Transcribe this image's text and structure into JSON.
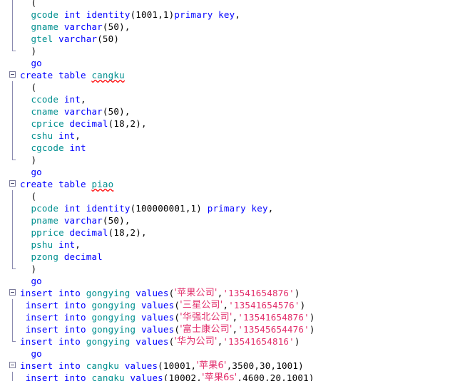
{
  "app": {
    "name": "sql-query-editor",
    "background": "#ffffff",
    "font_size_px": 12.5,
    "line_height_px": 17
  },
  "colors": {
    "keyword": "#0000ff",
    "identifier": "#008f8f",
    "string": "#e2306c",
    "plain": "#000000",
    "squiggle": "#ff0000",
    "region_bar": "#8b8bb0",
    "collapse_border": "#7d7d9c",
    "background": "#ffffff"
  },
  "icons": {
    "collapse": "minus-square-icon",
    "region_line": "region-bracket-icon"
  },
  "editor": {
    "lines": [
      {
        "n": 1,
        "gutter": "vbar",
        "tokens": [
          {
            "t": "  (",
            "c": "plain"
          }
        ]
      },
      {
        "n": 2,
        "gutter": "vbar",
        "tokens": [
          {
            "t": "  ",
            "c": "plain"
          },
          {
            "t": "gcode",
            "c": "ident"
          },
          {
            "t": " ",
            "c": "plain"
          },
          {
            "t": "int",
            "c": "kw"
          },
          {
            "t": " ",
            "c": "plain"
          },
          {
            "t": "identity",
            "c": "kw"
          },
          {
            "t": "(1001,1)",
            "c": "plain"
          },
          {
            "t": "primary key",
            "c": "kw"
          },
          {
            "t": ",",
            "c": "plain"
          }
        ]
      },
      {
        "n": 3,
        "gutter": "vbar",
        "tokens": [
          {
            "t": "  ",
            "c": "plain"
          },
          {
            "t": "gname",
            "c": "ident"
          },
          {
            "t": " ",
            "c": "plain"
          },
          {
            "t": "varchar",
            "c": "kw"
          },
          {
            "t": "(50),",
            "c": "plain"
          }
        ]
      },
      {
        "n": 4,
        "gutter": "vbar",
        "tokens": [
          {
            "t": "  ",
            "c": "plain"
          },
          {
            "t": "gtel",
            "c": "ident"
          },
          {
            "t": " ",
            "c": "plain"
          },
          {
            "t": "varchar",
            "c": "kw"
          },
          {
            "t": "(50)",
            "c": "plain"
          }
        ]
      },
      {
        "n": 5,
        "gutter": "lbar",
        "tokens": [
          {
            "t": "  )",
            "c": "plain"
          }
        ]
      },
      {
        "n": 6,
        "gutter": "none",
        "tokens": [
          {
            "t": "  ",
            "c": "plain"
          },
          {
            "t": "go",
            "c": "kw"
          }
        ]
      },
      {
        "n": 7,
        "gutter": "collapse",
        "tokens": [
          {
            "t": "create table",
            "c": "kw"
          },
          {
            "t": " ",
            "c": "plain"
          },
          {
            "t": "cangku",
            "c": "err"
          }
        ]
      },
      {
        "n": 8,
        "gutter": "vbar",
        "tokens": [
          {
            "t": "  (",
            "c": "plain"
          }
        ]
      },
      {
        "n": 9,
        "gutter": "vbar",
        "tokens": [
          {
            "t": "  ",
            "c": "plain"
          },
          {
            "t": "ccode",
            "c": "ident"
          },
          {
            "t": " ",
            "c": "plain"
          },
          {
            "t": "int",
            "c": "kw"
          },
          {
            "t": ",",
            "c": "plain"
          }
        ]
      },
      {
        "n": 10,
        "gutter": "vbar",
        "tokens": [
          {
            "t": "  ",
            "c": "plain"
          },
          {
            "t": "cname",
            "c": "ident"
          },
          {
            "t": " ",
            "c": "plain"
          },
          {
            "t": "varchar",
            "c": "kw"
          },
          {
            "t": "(50),",
            "c": "plain"
          }
        ]
      },
      {
        "n": 11,
        "gutter": "vbar",
        "tokens": [
          {
            "t": "  ",
            "c": "plain"
          },
          {
            "t": "cprice",
            "c": "ident"
          },
          {
            "t": " ",
            "c": "plain"
          },
          {
            "t": "decimal",
            "c": "kw"
          },
          {
            "t": "(18,2),",
            "c": "plain"
          }
        ]
      },
      {
        "n": 12,
        "gutter": "vbar",
        "tokens": [
          {
            "t": "  ",
            "c": "plain"
          },
          {
            "t": "cshu",
            "c": "ident"
          },
          {
            "t": " ",
            "c": "plain"
          },
          {
            "t": "int",
            "c": "kw"
          },
          {
            "t": ",",
            "c": "plain"
          }
        ]
      },
      {
        "n": 13,
        "gutter": "vbar",
        "tokens": [
          {
            "t": "  ",
            "c": "plain"
          },
          {
            "t": "cgcode",
            "c": "ident"
          },
          {
            "t": " ",
            "c": "plain"
          },
          {
            "t": "int",
            "c": "kw"
          }
        ]
      },
      {
        "n": 14,
        "gutter": "lbar",
        "tokens": [
          {
            "t": "  )",
            "c": "plain"
          }
        ]
      },
      {
        "n": 15,
        "gutter": "none",
        "tokens": [
          {
            "t": "  ",
            "c": "plain"
          },
          {
            "t": "go",
            "c": "kw"
          }
        ]
      },
      {
        "n": 16,
        "gutter": "collapse",
        "tokens": [
          {
            "t": "create table",
            "c": "kw"
          },
          {
            "t": " ",
            "c": "plain"
          },
          {
            "t": "piao",
            "c": "err"
          }
        ]
      },
      {
        "n": 17,
        "gutter": "vbar",
        "tokens": [
          {
            "t": "  (",
            "c": "plain"
          }
        ]
      },
      {
        "n": 18,
        "gutter": "vbar",
        "tokens": [
          {
            "t": "  ",
            "c": "plain"
          },
          {
            "t": "pcode",
            "c": "ident"
          },
          {
            "t": " ",
            "c": "plain"
          },
          {
            "t": "int",
            "c": "kw"
          },
          {
            "t": " ",
            "c": "plain"
          },
          {
            "t": "identity",
            "c": "kw"
          },
          {
            "t": "(100000001,1) ",
            "c": "plain"
          },
          {
            "t": "primary key",
            "c": "kw"
          },
          {
            "t": ",",
            "c": "plain"
          }
        ]
      },
      {
        "n": 19,
        "gutter": "vbar",
        "tokens": [
          {
            "t": "  ",
            "c": "plain"
          },
          {
            "t": "pname",
            "c": "ident"
          },
          {
            "t": " ",
            "c": "plain"
          },
          {
            "t": "varchar",
            "c": "kw"
          },
          {
            "t": "(50),",
            "c": "plain"
          }
        ]
      },
      {
        "n": 20,
        "gutter": "vbar",
        "tokens": [
          {
            "t": "  ",
            "c": "plain"
          },
          {
            "t": "pprice",
            "c": "ident"
          },
          {
            "t": " ",
            "c": "plain"
          },
          {
            "t": "decimal",
            "c": "kw"
          },
          {
            "t": "(18,2),",
            "c": "plain"
          }
        ]
      },
      {
        "n": 21,
        "gutter": "vbar",
        "tokens": [
          {
            "t": "  ",
            "c": "plain"
          },
          {
            "t": "pshu",
            "c": "ident"
          },
          {
            "t": " ",
            "c": "plain"
          },
          {
            "t": "int",
            "c": "kw"
          },
          {
            "t": ",",
            "c": "plain"
          }
        ]
      },
      {
        "n": 22,
        "gutter": "vbar",
        "tokens": [
          {
            "t": "  ",
            "c": "plain"
          },
          {
            "t": "pzong",
            "c": "ident"
          },
          {
            "t": " ",
            "c": "plain"
          },
          {
            "t": "decimal",
            "c": "kw"
          }
        ]
      },
      {
        "n": 23,
        "gutter": "lbar",
        "tokens": [
          {
            "t": "  )",
            "c": "plain"
          }
        ]
      },
      {
        "n": 24,
        "gutter": "none",
        "tokens": [
          {
            "t": "  ",
            "c": "plain"
          },
          {
            "t": "go",
            "c": "kw"
          }
        ]
      },
      {
        "n": 25,
        "gutter": "collapse",
        "tokens": [
          {
            "t": "insert into",
            "c": "kw"
          },
          {
            "t": " ",
            "c": "plain"
          },
          {
            "t": "gongying",
            "c": "ident"
          },
          {
            "t": " ",
            "c": "plain"
          },
          {
            "t": "values",
            "c": "kw"
          },
          {
            "t": "(",
            "c": "plain"
          },
          {
            "t": "'苹果公司'",
            "c": "str-cn"
          },
          {
            "t": ",",
            "c": "plain"
          },
          {
            "t": "'13541654876'",
            "c": "str"
          },
          {
            "t": ")",
            "c": "plain"
          }
        ]
      },
      {
        "n": 26,
        "gutter": "vbar",
        "tokens": [
          {
            "t": " ",
            "c": "plain"
          },
          {
            "t": "insert into",
            "c": "kw"
          },
          {
            "t": " ",
            "c": "plain"
          },
          {
            "t": "gongying",
            "c": "ident"
          },
          {
            "t": " ",
            "c": "plain"
          },
          {
            "t": "values",
            "c": "kw"
          },
          {
            "t": "(",
            "c": "plain"
          },
          {
            "t": "'三星公司'",
            "c": "str-cn"
          },
          {
            "t": ",",
            "c": "plain"
          },
          {
            "t": "'13541654576'",
            "c": "str"
          },
          {
            "t": ")",
            "c": "plain"
          }
        ]
      },
      {
        "n": 27,
        "gutter": "vbar",
        "tokens": [
          {
            "t": " ",
            "c": "plain"
          },
          {
            "t": "insert into",
            "c": "kw"
          },
          {
            "t": " ",
            "c": "plain"
          },
          {
            "t": "gongying",
            "c": "ident"
          },
          {
            "t": " ",
            "c": "plain"
          },
          {
            "t": "values",
            "c": "kw"
          },
          {
            "t": "(",
            "c": "plain"
          },
          {
            "t": "'华强北公司'",
            "c": "str-cn"
          },
          {
            "t": ",",
            "c": "plain"
          },
          {
            "t": "'13541654876'",
            "c": "str"
          },
          {
            "t": ")",
            "c": "plain"
          }
        ]
      },
      {
        "n": 28,
        "gutter": "vbar",
        "tokens": [
          {
            "t": " ",
            "c": "plain"
          },
          {
            "t": "insert into",
            "c": "kw"
          },
          {
            "t": " ",
            "c": "plain"
          },
          {
            "t": "gongying",
            "c": "ident"
          },
          {
            "t": " ",
            "c": "plain"
          },
          {
            "t": "values",
            "c": "kw"
          },
          {
            "t": "(",
            "c": "plain"
          },
          {
            "t": "'富士康公司'",
            "c": "str-cn"
          },
          {
            "t": ",",
            "c": "plain"
          },
          {
            "t": "'13545654476'",
            "c": "str"
          },
          {
            "t": ")",
            "c": "plain"
          }
        ]
      },
      {
        "n": 29,
        "gutter": "lbar-insert",
        "tokens": [
          {
            "t": "insert into",
            "c": "kw"
          },
          {
            "t": " ",
            "c": "plain"
          },
          {
            "t": "gongying",
            "c": "ident"
          },
          {
            "t": " ",
            "c": "plain"
          },
          {
            "t": "values",
            "c": "kw"
          },
          {
            "t": "(",
            "c": "plain"
          },
          {
            "t": "'华为公司'",
            "c": "str-cn"
          },
          {
            "t": ",",
            "c": "plain"
          },
          {
            "t": "'13541654816'",
            "c": "str"
          },
          {
            "t": ")",
            "c": "plain"
          }
        ]
      },
      {
        "n": 30,
        "gutter": "none",
        "tokens": [
          {
            "t": "  ",
            "c": "plain"
          },
          {
            "t": "go",
            "c": "kw"
          }
        ]
      },
      {
        "n": 31,
        "gutter": "collapse",
        "tokens": [
          {
            "t": "insert into",
            "c": "kw"
          },
          {
            "t": " ",
            "c": "plain"
          },
          {
            "t": "cangku",
            "c": "ident"
          },
          {
            "t": " ",
            "c": "plain"
          },
          {
            "t": "values",
            "c": "kw"
          },
          {
            "t": "(10001,",
            "c": "plain"
          },
          {
            "t": "'苹果6'",
            "c": "str-cn"
          },
          {
            "t": ",3500,30,1001)",
            "c": "plain"
          }
        ]
      },
      {
        "n": 32,
        "gutter": "vbar",
        "tokens": [
          {
            "t": " ",
            "c": "plain"
          },
          {
            "t": "insert into",
            "c": "kw"
          },
          {
            "t": " ",
            "c": "plain"
          },
          {
            "t": "cangku",
            "c": "ident"
          },
          {
            "t": " ",
            "c": "plain"
          },
          {
            "t": "values",
            "c": "kw"
          },
          {
            "t": "(10002,",
            "c": "plain"
          },
          {
            "t": "'苹果6s'",
            "c": "str-cn"
          },
          {
            "t": ",4600,20,1001)",
            "c": "plain"
          }
        ]
      }
    ]
  }
}
